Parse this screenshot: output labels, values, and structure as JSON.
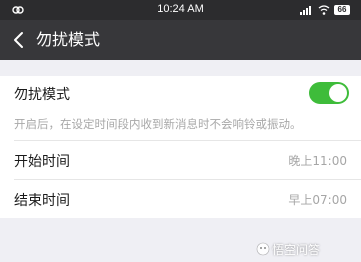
{
  "status_bar": {
    "time": "10:24 AM",
    "battery": "66"
  },
  "header": {
    "title": "勿扰模式"
  },
  "settings": {
    "dnd": {
      "label": "勿扰模式",
      "enabled": true,
      "description": "开启后，在设定时间段内收到新消息时不会响铃或振动。"
    },
    "start": {
      "label": "开始时间",
      "value": "晚上11:00"
    },
    "end": {
      "label": "结束时间",
      "value": "早上07:00"
    }
  },
  "watermark": {
    "text": "悟空问答"
  },
  "colors": {
    "toggle_on": "#3ebc3a",
    "nav_bg": "#37373a"
  }
}
